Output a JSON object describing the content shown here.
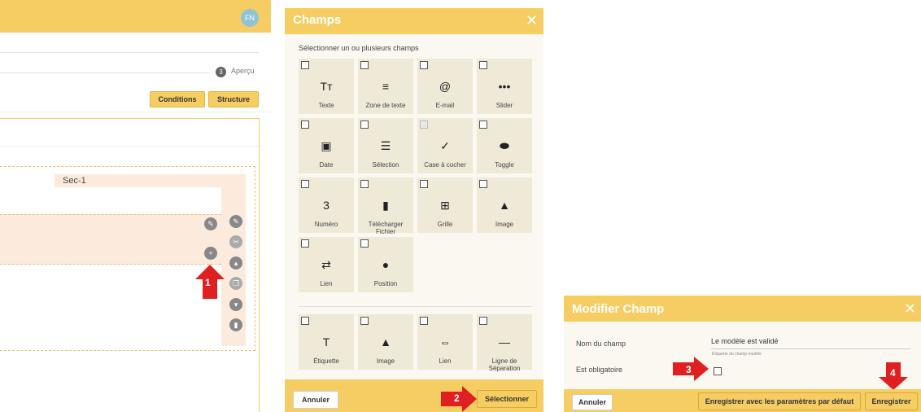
{
  "left": {
    "avatar_initials": "FN",
    "step": {
      "number": "3",
      "label": "Aperçu"
    },
    "buttons": {
      "conditions": "Conditions",
      "structure": "Structure"
    },
    "section_label": "Sec-1",
    "marker": "1"
  },
  "champs": {
    "title": "Champs",
    "close": "✕",
    "subtitle": "Sélectionner un ou plusieurs champs",
    "fields": [
      {
        "label": "Texte",
        "icon": "Tт",
        "checked": false
      },
      {
        "label": "Zone de texte",
        "icon": "≡",
        "checked": false
      },
      {
        "label": "E-mail",
        "icon": "@",
        "checked": false
      },
      {
        "label": "Slider",
        "icon": "•••",
        "checked": false
      },
      {
        "label": "Date",
        "icon": "▣",
        "checked": false
      },
      {
        "label": "Sélection",
        "icon": "☰",
        "checked": false
      },
      {
        "label": "Case à cocher",
        "icon": "✓",
        "checked": true
      },
      {
        "label": "Toggle",
        "icon": "⬬",
        "checked": false
      },
      {
        "label": "Numéro",
        "icon": "3",
        "checked": false
      },
      {
        "label": "Télécharger Fichier",
        "icon": "▮",
        "checked": false
      },
      {
        "label": "Grille",
        "icon": "⊞",
        "checked": false
      },
      {
        "label": "Image",
        "icon": "▲",
        "checked": false
      },
      {
        "label": "Lien",
        "icon": "⇄",
        "checked": false
      },
      {
        "label": "Position",
        "icon": "●",
        "checked": false
      }
    ],
    "layout_fields": [
      {
        "label": "Étiquette",
        "icon": "T",
        "checked": false
      },
      {
        "label": "Image",
        "icon": "▲",
        "checked": false
      },
      {
        "label": "Lien",
        "icon": "⇔",
        "checked": false
      },
      {
        "label": "Ligne de Séparation",
        "icon": "—",
        "checked": false
      }
    ],
    "cancel": "Annuler",
    "select": "Sélectionner",
    "marker": "2"
  },
  "modif": {
    "title": "Modifier Champ",
    "close": "✕",
    "name_label": "Nom du champ",
    "name_value": "Le modèle est validé",
    "name_hint": "Étiquette du champ modèle",
    "required_label": "Est obligatoire",
    "cancel": "Annuler",
    "save_default": "Enregistrer avec les paramètres par défaut",
    "save": "Enregistrer",
    "marker3": "3",
    "marker4": "4"
  },
  "colors": {
    "accent": "#f6cd63",
    "marker": "#e02020",
    "tile": "#efe9d8"
  }
}
